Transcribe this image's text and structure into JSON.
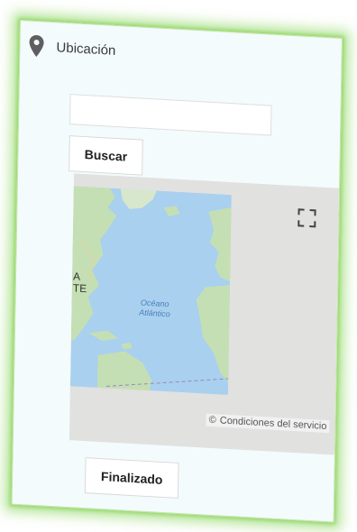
{
  "panel": {
    "title": "Ubicación",
    "icon": "map-pin-icon"
  },
  "search": {
    "value": "",
    "placeholder": "",
    "button_label": "Buscar"
  },
  "map": {
    "ocean_label": "Océano Atlántico",
    "ocean_label_line1": "Océano",
    "ocean_label_line2": "Atlántico",
    "left_edge_labels": [
      "A",
      "TE"
    ],
    "copyright_symbol": "©",
    "terms_link": "Condiciones del servicio",
    "fullscreen_icon": "fullscreen-icon"
  },
  "actions": {
    "done_label": "Finalizado"
  },
  "colors": {
    "glow": "#7dd24b",
    "card_bg": "#f3fbfd",
    "water": "#a9d0ef",
    "land": "#c5dfb4",
    "map_bg": "#e1e1df"
  }
}
